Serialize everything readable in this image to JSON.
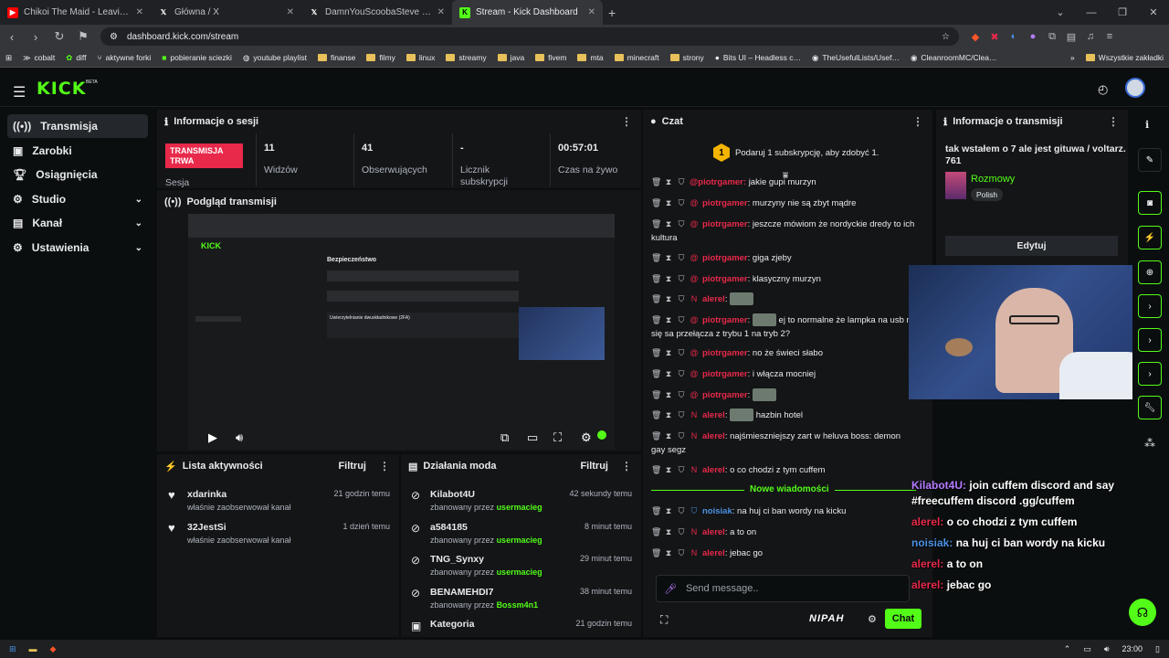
{
  "browser": {
    "tabs": [
      {
        "title": "Chikoi The Maid - Leaving The R…",
        "favicon": "youtube-icon",
        "active": false
      },
      {
        "title": "Główna / X",
        "favicon": "x-icon",
        "active": false
      },
      {
        "title": "DamnYouScoobaSteve w serwisie X:…",
        "favicon": "x-icon",
        "active": false
      },
      {
        "title": "Stream - Kick Dashboard",
        "favicon": "kick-icon",
        "active": true
      }
    ],
    "url": "dashboard.kick.com/stream",
    "bookmarks": [
      "cobalt",
      "diff",
      "aktywne forki",
      "pobieranie sciezki",
      "youtube playlist",
      "finanse",
      "filmy",
      "linux",
      "streamy",
      "java",
      "fivem",
      "mta",
      "minecraft",
      "strony",
      "Bits UI – Headless c…",
      "TheUsefulLists/Usef…",
      "CleanroomMC/Clea…"
    ],
    "bookmarks_other": "Wszystkie zakładki"
  },
  "app": {
    "logo": "KICK",
    "beta": "BETA",
    "accent": "#53fc18",
    "nav": [
      {
        "label": "Transmisja",
        "icon": "broadcast-icon",
        "active": true,
        "expandable": false
      },
      {
        "label": "Zarobki",
        "icon": "wallet-icon",
        "active": false,
        "expandable": false
      },
      {
        "label": "Osiągnięcia",
        "icon": "trophy-icon",
        "active": false,
        "expandable": false
      },
      {
        "label": "Studio",
        "icon": "gear-icon",
        "active": false,
        "expandable": true
      },
      {
        "label": "Kanał",
        "icon": "channel-icon",
        "active": false,
        "expandable": true
      },
      {
        "label": "Ustawienia",
        "icon": "settings-icon",
        "active": false,
        "expandable": true
      }
    ]
  },
  "session": {
    "title": "Informacje o sesji",
    "live_label": "TRANSMISJA TRWA",
    "session_label": "Sesja",
    "stats": [
      {
        "value": "11",
        "label": "Widzów"
      },
      {
        "value": "41",
        "label": "Obserwujących"
      },
      {
        "value": "-",
        "label": "Licznik subskrypcji"
      },
      {
        "value": "00:57:01",
        "label": "Czas na żywo"
      }
    ]
  },
  "preview": {
    "title": "Podgląd transmisji",
    "inner_heading": "Bezpieczeństwo",
    "inner_section": "Uwierzytelnianie dwuskładnikowe (2FA)"
  },
  "activity": {
    "title": "Lista aktywności",
    "filter": "Filtruj",
    "items": [
      {
        "name": "xdarinka",
        "desc": "właśnie zaobserwował kanał",
        "time": "21 godzin temu"
      },
      {
        "name": "32JestSi",
        "desc": "właśnie zaobserwował kanał",
        "time": "1 dzień temu"
      }
    ]
  },
  "modactions": {
    "title": "Działania moda",
    "filter": "Filtruj",
    "by": "zbanowany przez",
    "items": [
      {
        "name": "Kilabot4U",
        "mod": "usermacieg",
        "time": "42 sekundy temu"
      },
      {
        "name": "a584185",
        "mod": "usermacieg",
        "time": "8 minut temu"
      },
      {
        "name": "TNG_Synxy",
        "mod": "usermacieg",
        "time": "29 minut temu"
      },
      {
        "name": "BENAMEHDI7",
        "mod": "Bossm4n1",
        "time": "38 minut temu"
      },
      {
        "name": "Kategoria",
        "mod": "",
        "time": "21 godzin temu"
      }
    ]
  },
  "chat": {
    "title": "Czat",
    "promo": "Podaruj 1 subskrypcję, aby zdobyć 1.",
    "partial_top": "jakie gupi murzyn",
    "messages": [
      {
        "user": "piotrgamer",
        "color": "#e8294a",
        "text": "murzyny nie są zbyt mądre"
      },
      {
        "user": "piotrgamer",
        "color": "#e8294a",
        "text": "jeszcze mówiom że nordyckie dredy to ich kultura"
      },
      {
        "user": "piotrgamer",
        "color": "#e8294a",
        "text": "giga zjeby"
      },
      {
        "user": "piotrgamer",
        "color": "#e8294a",
        "text": "klasyczny murzyn"
      },
      {
        "user": "alerel",
        "color": "#e8294a",
        "text": ""
      },
      {
        "user": "piotrgamer",
        "color": "#e8294a",
        "text": "ej to normalne że lampka na usb mi się sa przełącza z trybu 1 na tryb 2?"
      },
      {
        "user": "piotrgamer",
        "color": "#e8294a",
        "text": "no że świeci słabo"
      },
      {
        "user": "piotrgamer",
        "color": "#e8294a",
        "text": "i włącza mocniej"
      },
      {
        "user": "piotrgamer",
        "color": "#e8294a",
        "text": ""
      },
      {
        "user": "alerel",
        "color": "#e8294a",
        "text": "hazbin hotel"
      },
      {
        "user": "alerel",
        "color": "#e8294a",
        "text": "najśmieszniejszy zart w heluva boss: demon gay segz"
      },
      {
        "user": "alerel",
        "color": "#e8294a",
        "text": "o co chodzi z tym cuffem"
      }
    ],
    "new_messages": "Nowe wiadomości",
    "new": [
      {
        "user": "noisiak",
        "color": "#4a90e2",
        "text": "na huj ci ban wordy na kicku"
      },
      {
        "user": "alerel",
        "color": "#e8294a",
        "text": "a to on"
      },
      {
        "user": "alerel",
        "color": "#e8294a",
        "text": "jebac go"
      }
    ],
    "input_placeholder": "Send message..",
    "nipah": "NIPAH",
    "send": "Chat"
  },
  "streaminfo": {
    "title": "Informacje o transmisji",
    "stream_title": "tak wstałem o 7 ale jest gituwa / voltarz. 761",
    "category": "Rozmowy",
    "language": "Polish",
    "edit": "Edytuj"
  },
  "overlay": [
    {
      "user": "Kilabot4U",
      "color": "#b57cff",
      "text": "join cuffem discord and say #freecuffem discord .gg/cuffem"
    },
    {
      "user": "alerel",
      "color": "#e8294a",
      "text": "o co chodzi z tym cuffem"
    },
    {
      "user": "noisiak",
      "color": "#4a90e2",
      "text": "na huj ci ban wordy na kicku"
    },
    {
      "user": "alerel",
      "color": "#e8294a",
      "text": "a to on"
    },
    {
      "user": "alerel",
      "color": "#e8294a",
      "text": "jebac go"
    }
  ],
  "taskbar": {
    "time": "23:00"
  }
}
